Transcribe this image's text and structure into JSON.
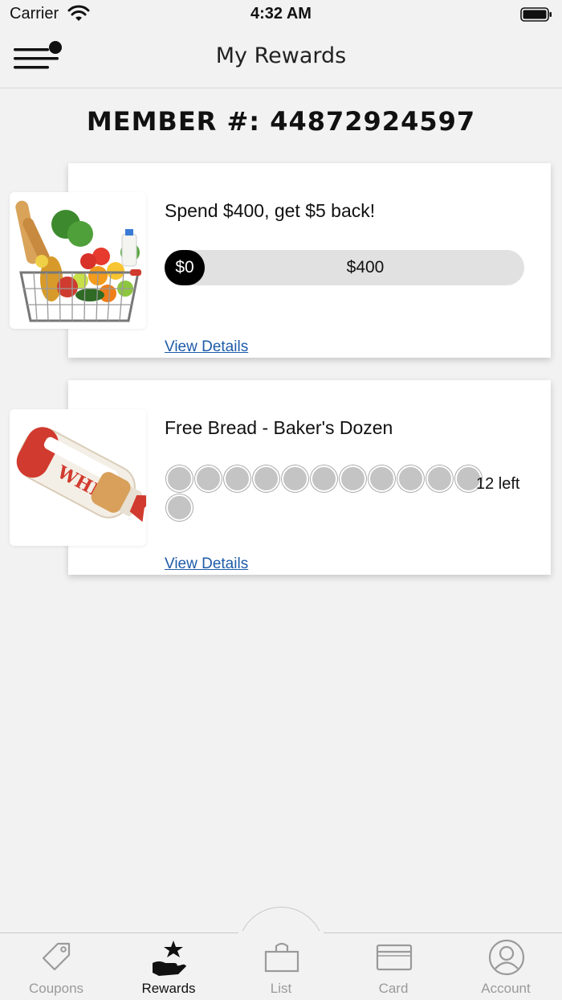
{
  "status_bar": {
    "carrier": "Carrier",
    "time": "4:32 AM"
  },
  "nav": {
    "title": "My Rewards"
  },
  "member": {
    "label": "MEMBER #: 44872924597"
  },
  "rewards": [
    {
      "title": "Spend $400, get $5 back!",
      "progress_start": "$0",
      "progress_goal": "$400",
      "progress_fraction": 0,
      "link": "View Details",
      "image_icon": "grocery-basket-image"
    },
    {
      "title": "Free Bread - Baker's Dozen",
      "punches_total": 12,
      "punches_filled": 0,
      "remaining": "12 left",
      "link": "View Details",
      "image_icon": "bread-loaf-image"
    }
  ],
  "tabs": [
    {
      "label": "Coupons",
      "icon": "tag-icon",
      "active": false
    },
    {
      "label": "Rewards",
      "icon": "hand-star-icon",
      "active": true
    },
    {
      "label": "List",
      "icon": "bag-icon",
      "active": false
    },
    {
      "label": "Card",
      "icon": "card-icon",
      "active": false
    },
    {
      "label": "Account",
      "icon": "user-circle-icon",
      "active": false
    }
  ],
  "colors": {
    "link": "#1e5ba8",
    "background": "#f2f2f2",
    "active_tab": "#111111",
    "inactive_tab": "#9a9a9a"
  }
}
